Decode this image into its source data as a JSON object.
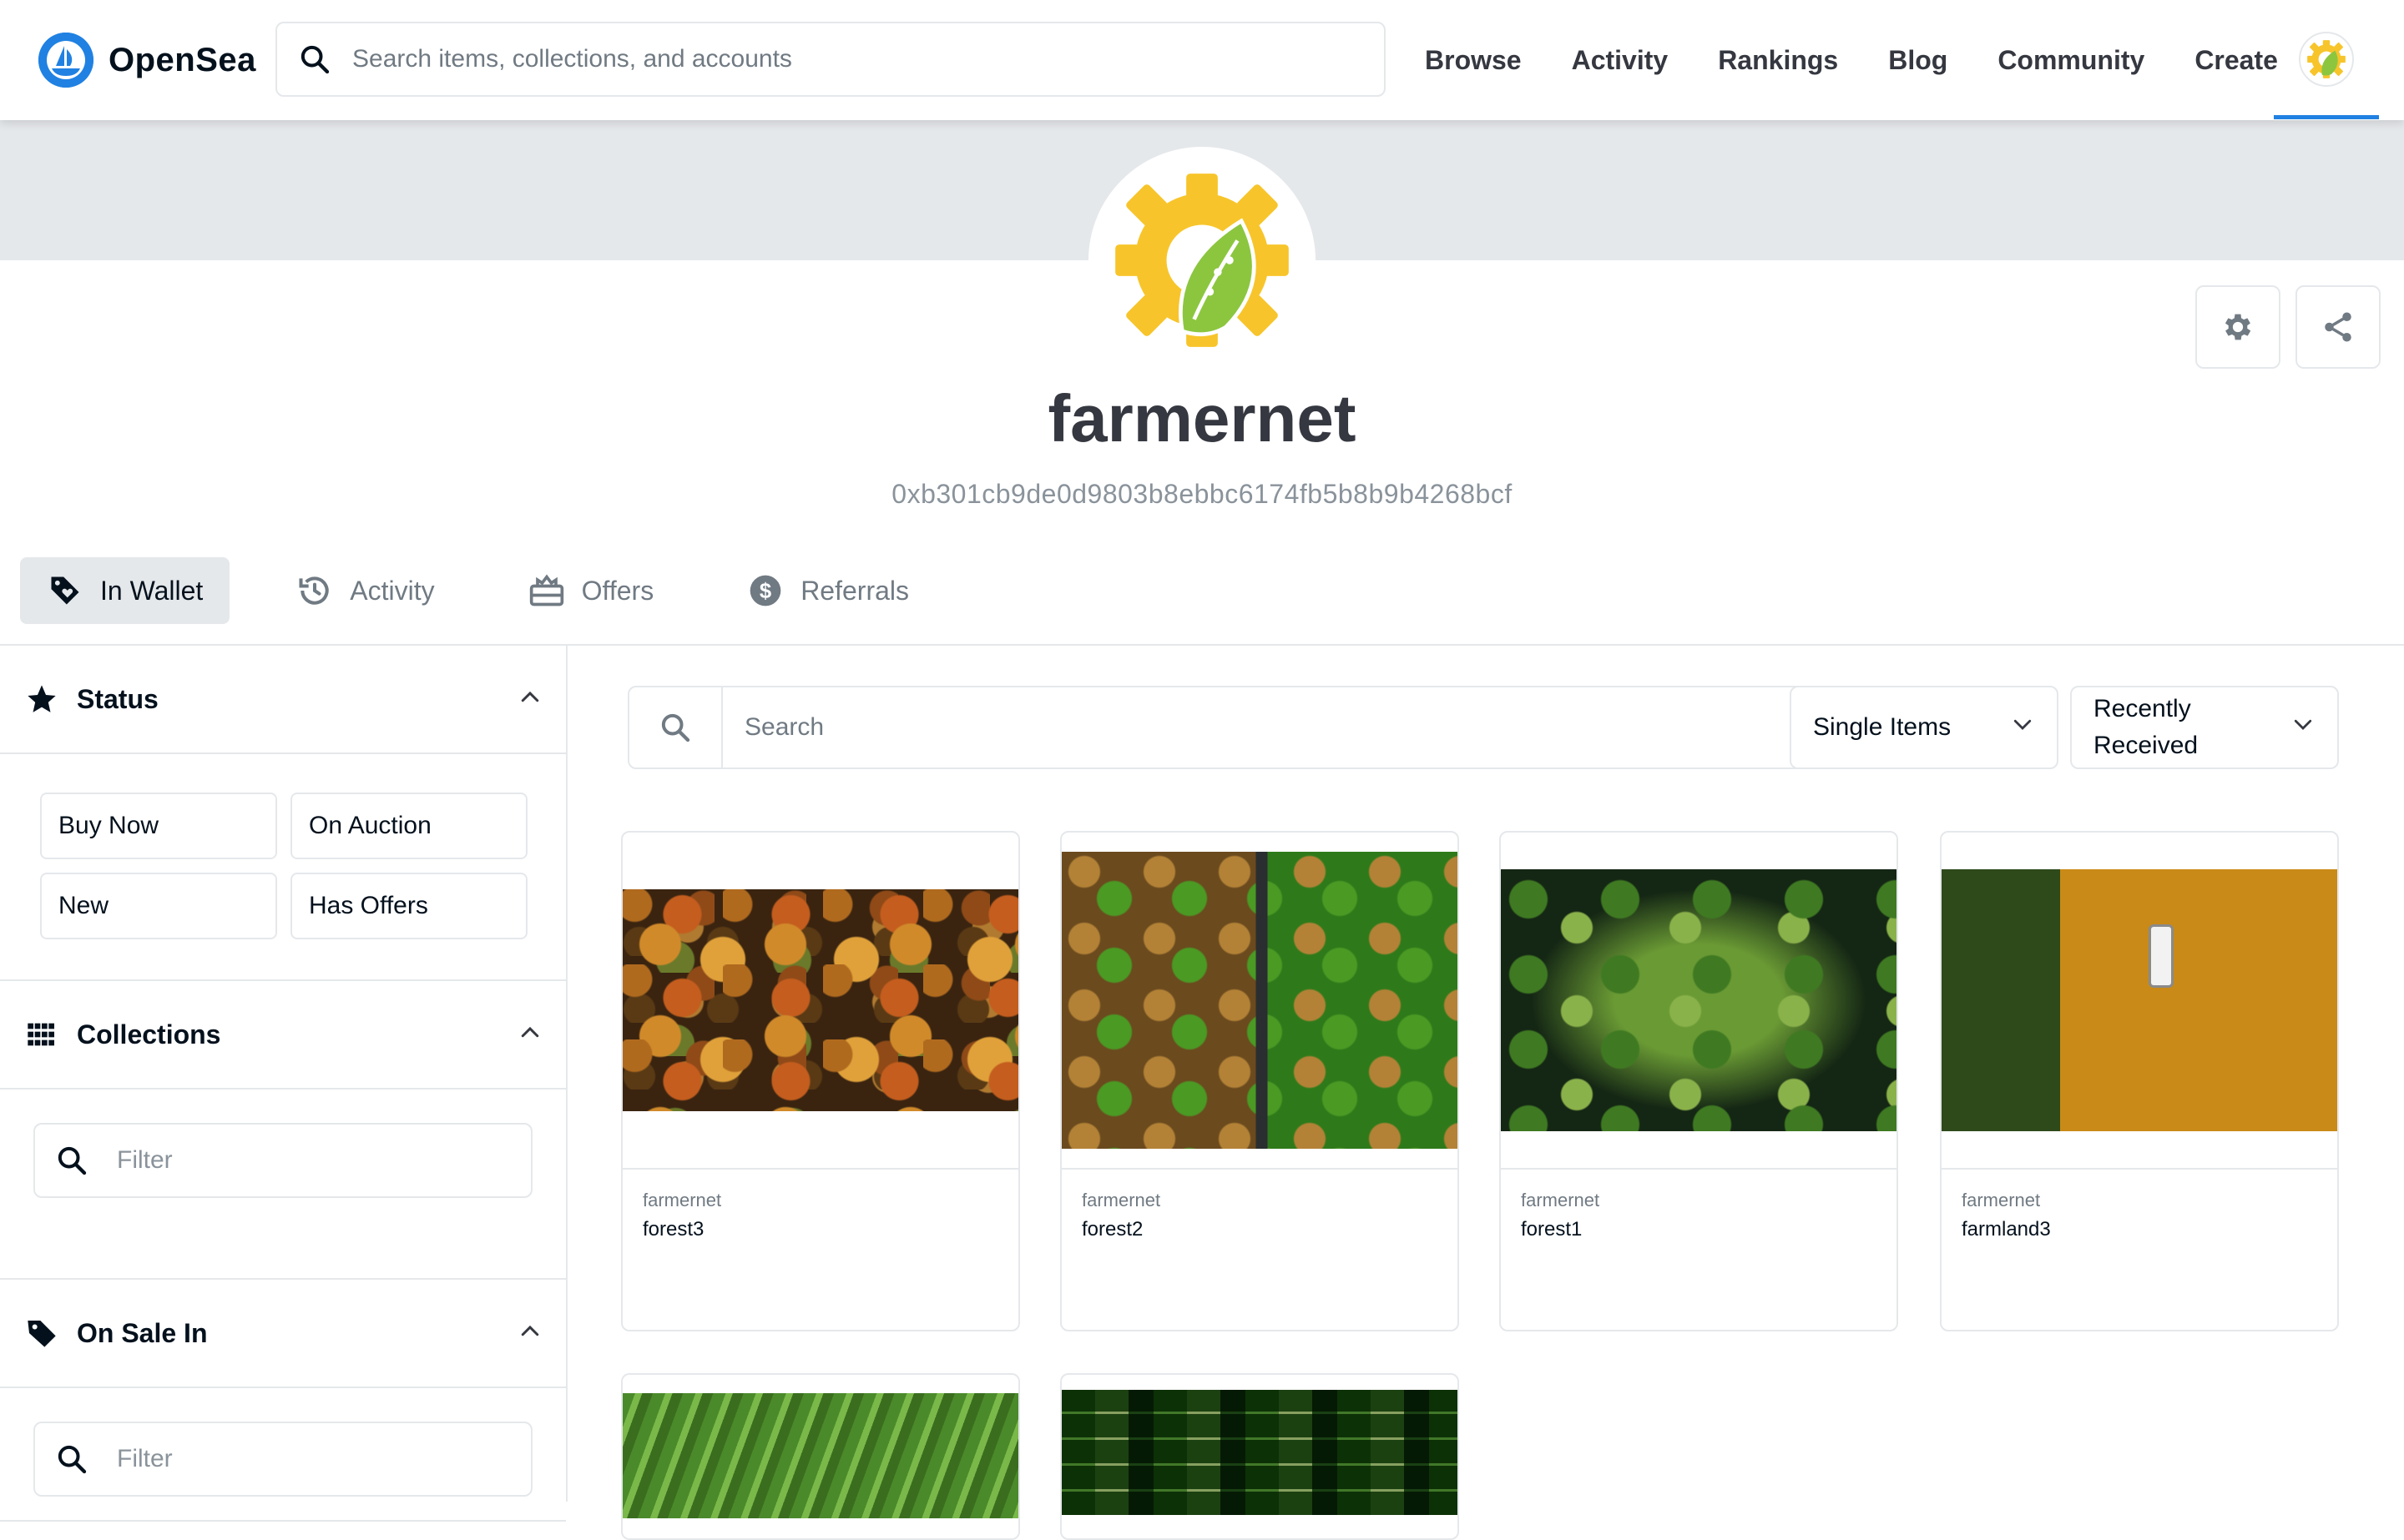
{
  "nav": {
    "brand": "OpenSea",
    "search_placeholder": "Search items, collections, and accounts",
    "links": [
      "Browse",
      "Activity",
      "Rankings",
      "Blog",
      "Community",
      "Create"
    ]
  },
  "profile": {
    "username": "farmernet",
    "address": "0xb301cb9de0d9803b8ebbc6174fb5b8b9b4268bcf"
  },
  "tabs": [
    {
      "label": "In Wallet",
      "icon": "tag-heart-icon",
      "active": true
    },
    {
      "label": "Activity",
      "icon": "history-icon",
      "active": false
    },
    {
      "label": "Offers",
      "icon": "offers-icon",
      "active": false
    },
    {
      "label": "Referrals",
      "icon": "dollar-circle-icon",
      "active": false
    }
  ],
  "sidebar": {
    "status": {
      "title": "Status",
      "options": [
        "Buy Now",
        "On Auction",
        "New",
        "Has Offers"
      ]
    },
    "collections": {
      "title": "Collections",
      "filter_placeholder": "Filter"
    },
    "on_sale_in": {
      "title": "On Sale In",
      "filter_placeholder": "Filter"
    }
  },
  "main": {
    "search_placeholder": "Search",
    "item_type": "Single Items",
    "sort_line1": "Recently",
    "sort_line2": "Received"
  },
  "cards": [
    {
      "collection": "farmernet",
      "name": "forest3"
    },
    {
      "collection": "farmernet",
      "name": "forest2"
    },
    {
      "collection": "farmernet",
      "name": "forest1"
    },
    {
      "collection": "farmernet",
      "name": "farmland3"
    }
  ],
  "colors": {
    "accent": "#2081e2",
    "gear_yellow": "#f7c52b",
    "leaf_green": "#8cc63f"
  }
}
